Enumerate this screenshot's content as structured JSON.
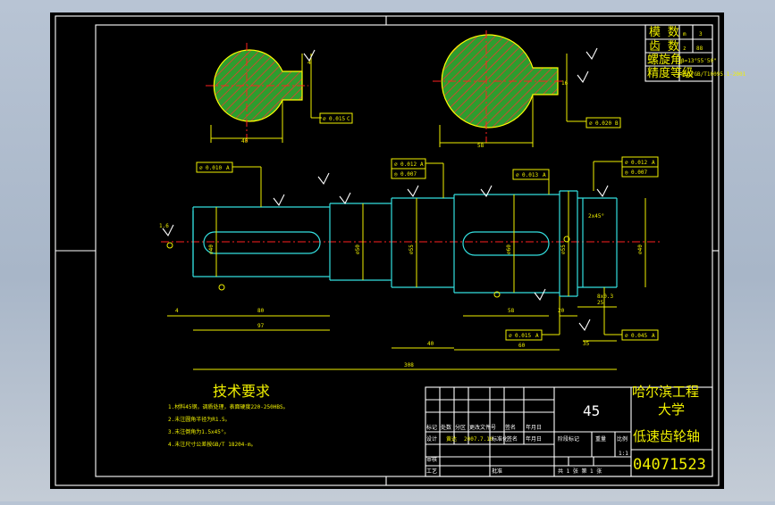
{
  "spec_table": [
    {
      "label": "模 数",
      "symbol": "m",
      "value": "3"
    },
    {
      "label": "齿 数",
      "symbol": "z",
      "value": "88"
    },
    {
      "label": "螺旋角",
      "symbol": "",
      "value": "β=13°55'50\""
    },
    {
      "label": "精度等级",
      "symbol": "",
      "value": "8GJ/GB/T10095.1-2001"
    }
  ],
  "tech_requirements": {
    "title": "技术要求",
    "items": [
      "1.材料45钢，调质处理，表面硬度220-250HBS。",
      "2.未注圆角半径为R1.5。",
      "3.未注倒角为1.5x45°。",
      "4.未注尺寸公差按GB/T 18204-m。"
    ]
  },
  "title_block": {
    "material": "45",
    "school": "哈尔滨工程大学",
    "part_name": "低速齿轮轴",
    "drawing_no": "04071523",
    "row_labels": [
      "标记",
      "处数",
      "分区",
      "更改文件号",
      "签名",
      "年月日"
    ],
    "design_row": [
      "设计",
      "黄达",
      "2007.7.10",
      "标准化",
      "签名",
      "年月日"
    ],
    "stage_label": "阶段标记",
    "weight_label": "重量",
    "scale_label": "比例",
    "scale_value": "1:1",
    "review_label": "审核",
    "process_label": "工艺",
    "approve_label": "批准",
    "sheets_text": "共 1 张  第 1 张"
  },
  "tolerance_frames": [
    {
      "sym": "⌀",
      "val": "0.015",
      "ref": "C"
    },
    {
      "sym": "⌀",
      "val": "0.020",
      "ref": "B"
    },
    {
      "sym": "⌀",
      "val": "0.010",
      "ref": "A"
    },
    {
      "sym": "⌀",
      "val": "0.012",
      "ref": "A"
    },
    {
      "sym": "◎",
      "val": "0.007",
      "ref": ""
    },
    {
      "sym": "⌀",
      "val": "0.015",
      "ref": "A"
    },
    {
      "sym": "◎",
      "val": "0.007",
      "ref": ""
    },
    {
      "sym": "⌀",
      "val": "0.012",
      "ref": "A"
    },
    {
      "sym": "⌀",
      "val": "0.013",
      "ref": "A"
    },
    {
      "sym": "⌀",
      "val": "0.015",
      "ref": "A"
    },
    {
      "sym": "⌀",
      "val": "0.045",
      "ref": "A"
    }
  ],
  "dimensions": {
    "left_section_width": "40",
    "right_section_width": "58",
    "left_key_len": "80",
    "left_full_len": "97",
    "mid_len": "40",
    "right_key_len": "58",
    "right_step_len": "60",
    "total_len": "308",
    "d1": "⌀40",
    "d2": "⌀50",
    "d3": "⌀55",
    "d4": "⌀60",
    "d5": "⌀55",
    "d6": "⌀40",
    "shoulder": "20",
    "chamfer": "2x45°",
    "right_len": "35",
    "r_length": "4",
    "rough_right": "8x0.3",
    "small_right": "25",
    "keyway1": "4",
    "keyway2": "16",
    "ra": "1.6"
  },
  "colors": {
    "background": "#000000",
    "frame": "#ffffff",
    "part": "#33e0e0",
    "annotation": "#f0f000",
    "centerline": "#ff2020"
  }
}
